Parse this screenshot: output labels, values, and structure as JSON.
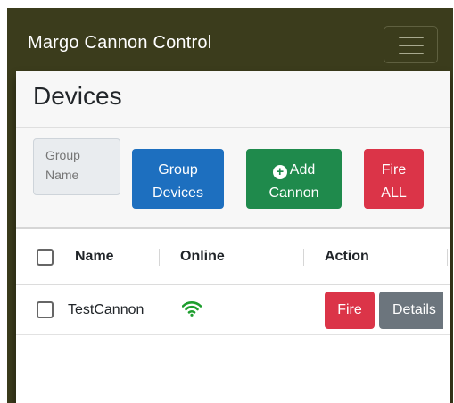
{
  "navbar": {
    "brand": "Margo Cannon Control",
    "toggler_icon": "hamburger-menu-icon"
  },
  "card": {
    "title": "Devices"
  },
  "toolbar": {
    "group_name_placeholder": "Group Name",
    "group_devices_label": "Group Devices",
    "add_cannon_icon": "plus-circle-icon",
    "add_cannon_label": "Add Cannon",
    "fire_all_label": "Fire ALL"
  },
  "table": {
    "headers": [
      "Name",
      "Online",
      "Action"
    ],
    "rows": [
      {
        "name": "TestCannon",
        "online_icon": "wifi-icon",
        "fire_label": "Fire",
        "details_label": "Details"
      }
    ]
  },
  "colors": {
    "navbar_bg": "#3b3c1c",
    "primary": "#1d6fbf",
    "success": "#1f8a4c",
    "danger": "#db3448",
    "secondary": "#6c757d",
    "online": "#1e9e2e"
  }
}
